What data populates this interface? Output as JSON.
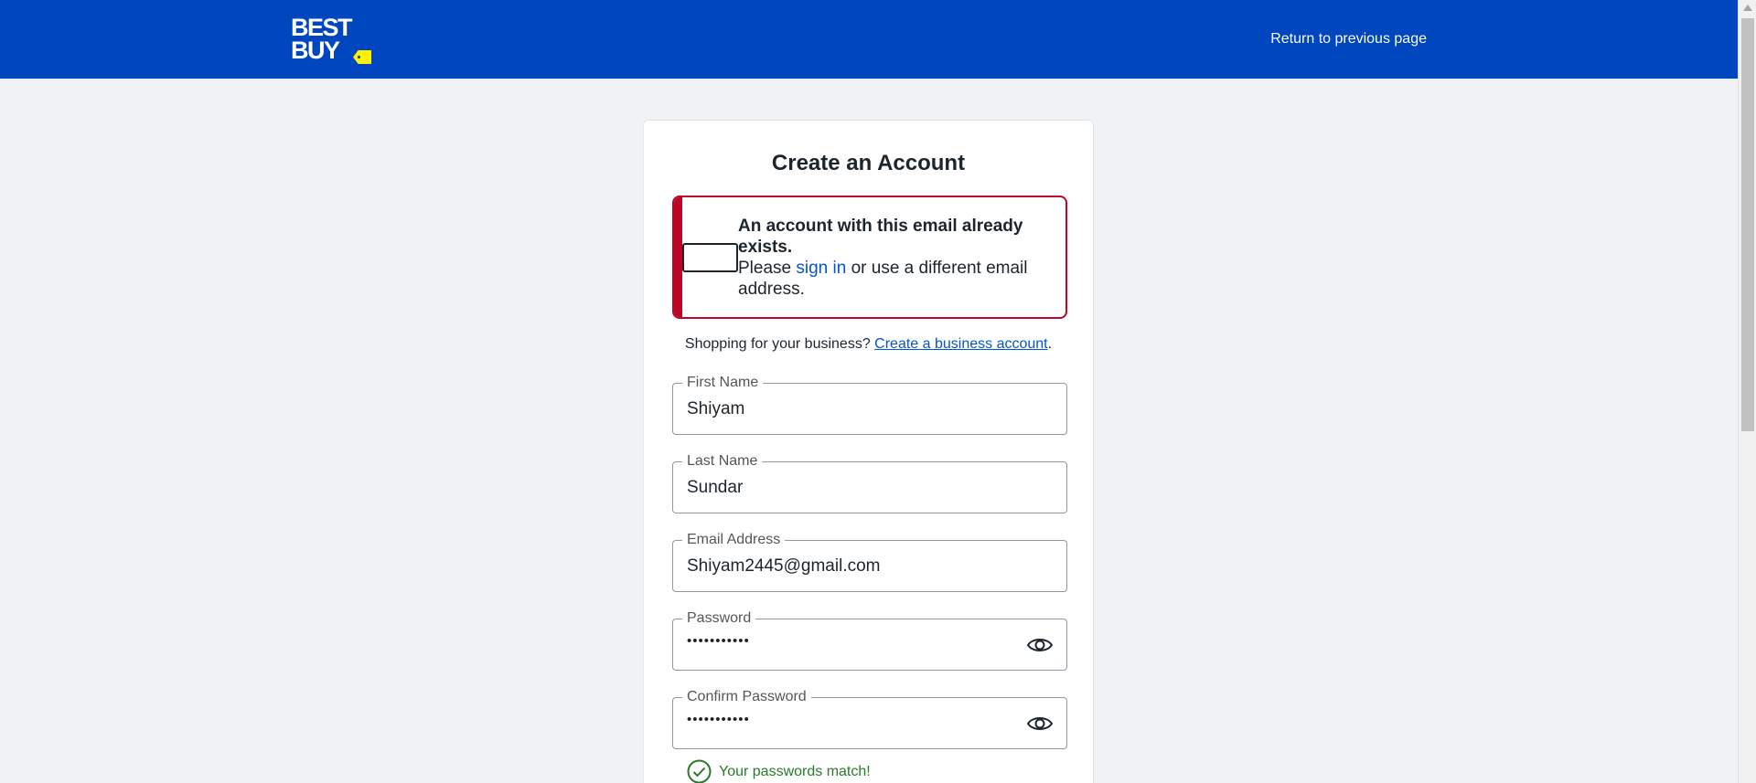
{
  "header": {
    "logo": {
      "line1": "BEST",
      "line2": "BUY"
    },
    "return_link": "Return to previous page"
  },
  "form": {
    "title": "Create an Account",
    "alert": {
      "title": "An account with this email already exists.",
      "prefix": "Please ",
      "sign_in_link": "sign in",
      "suffix": " or use a different email address."
    },
    "business": {
      "prefix": "Shopping for your business? ",
      "link": "Create a business account",
      "suffix": "."
    },
    "fields": {
      "first_name": {
        "label": "First Name",
        "value": "Shiyam"
      },
      "last_name": {
        "label": "Last Name",
        "value": "Sundar"
      },
      "email": {
        "label": "Email Address",
        "value": "Shiyam2445@gmail.com"
      },
      "password": {
        "label": "Password",
        "value": "•••••••••••"
      },
      "confirm_password": {
        "label": "Confirm Password",
        "value": "•••••••••••"
      }
    },
    "password_match": "Your passwords match!"
  },
  "colors": {
    "header_blue": "#0046be",
    "logo_yellow": "#fff200",
    "error_red": "#bb0628",
    "link_blue": "#0457c8",
    "success_green": "#2a7a2a"
  },
  "icons": [
    "logo-tag-icon",
    "eye-icon",
    "check-circle-icon"
  ]
}
